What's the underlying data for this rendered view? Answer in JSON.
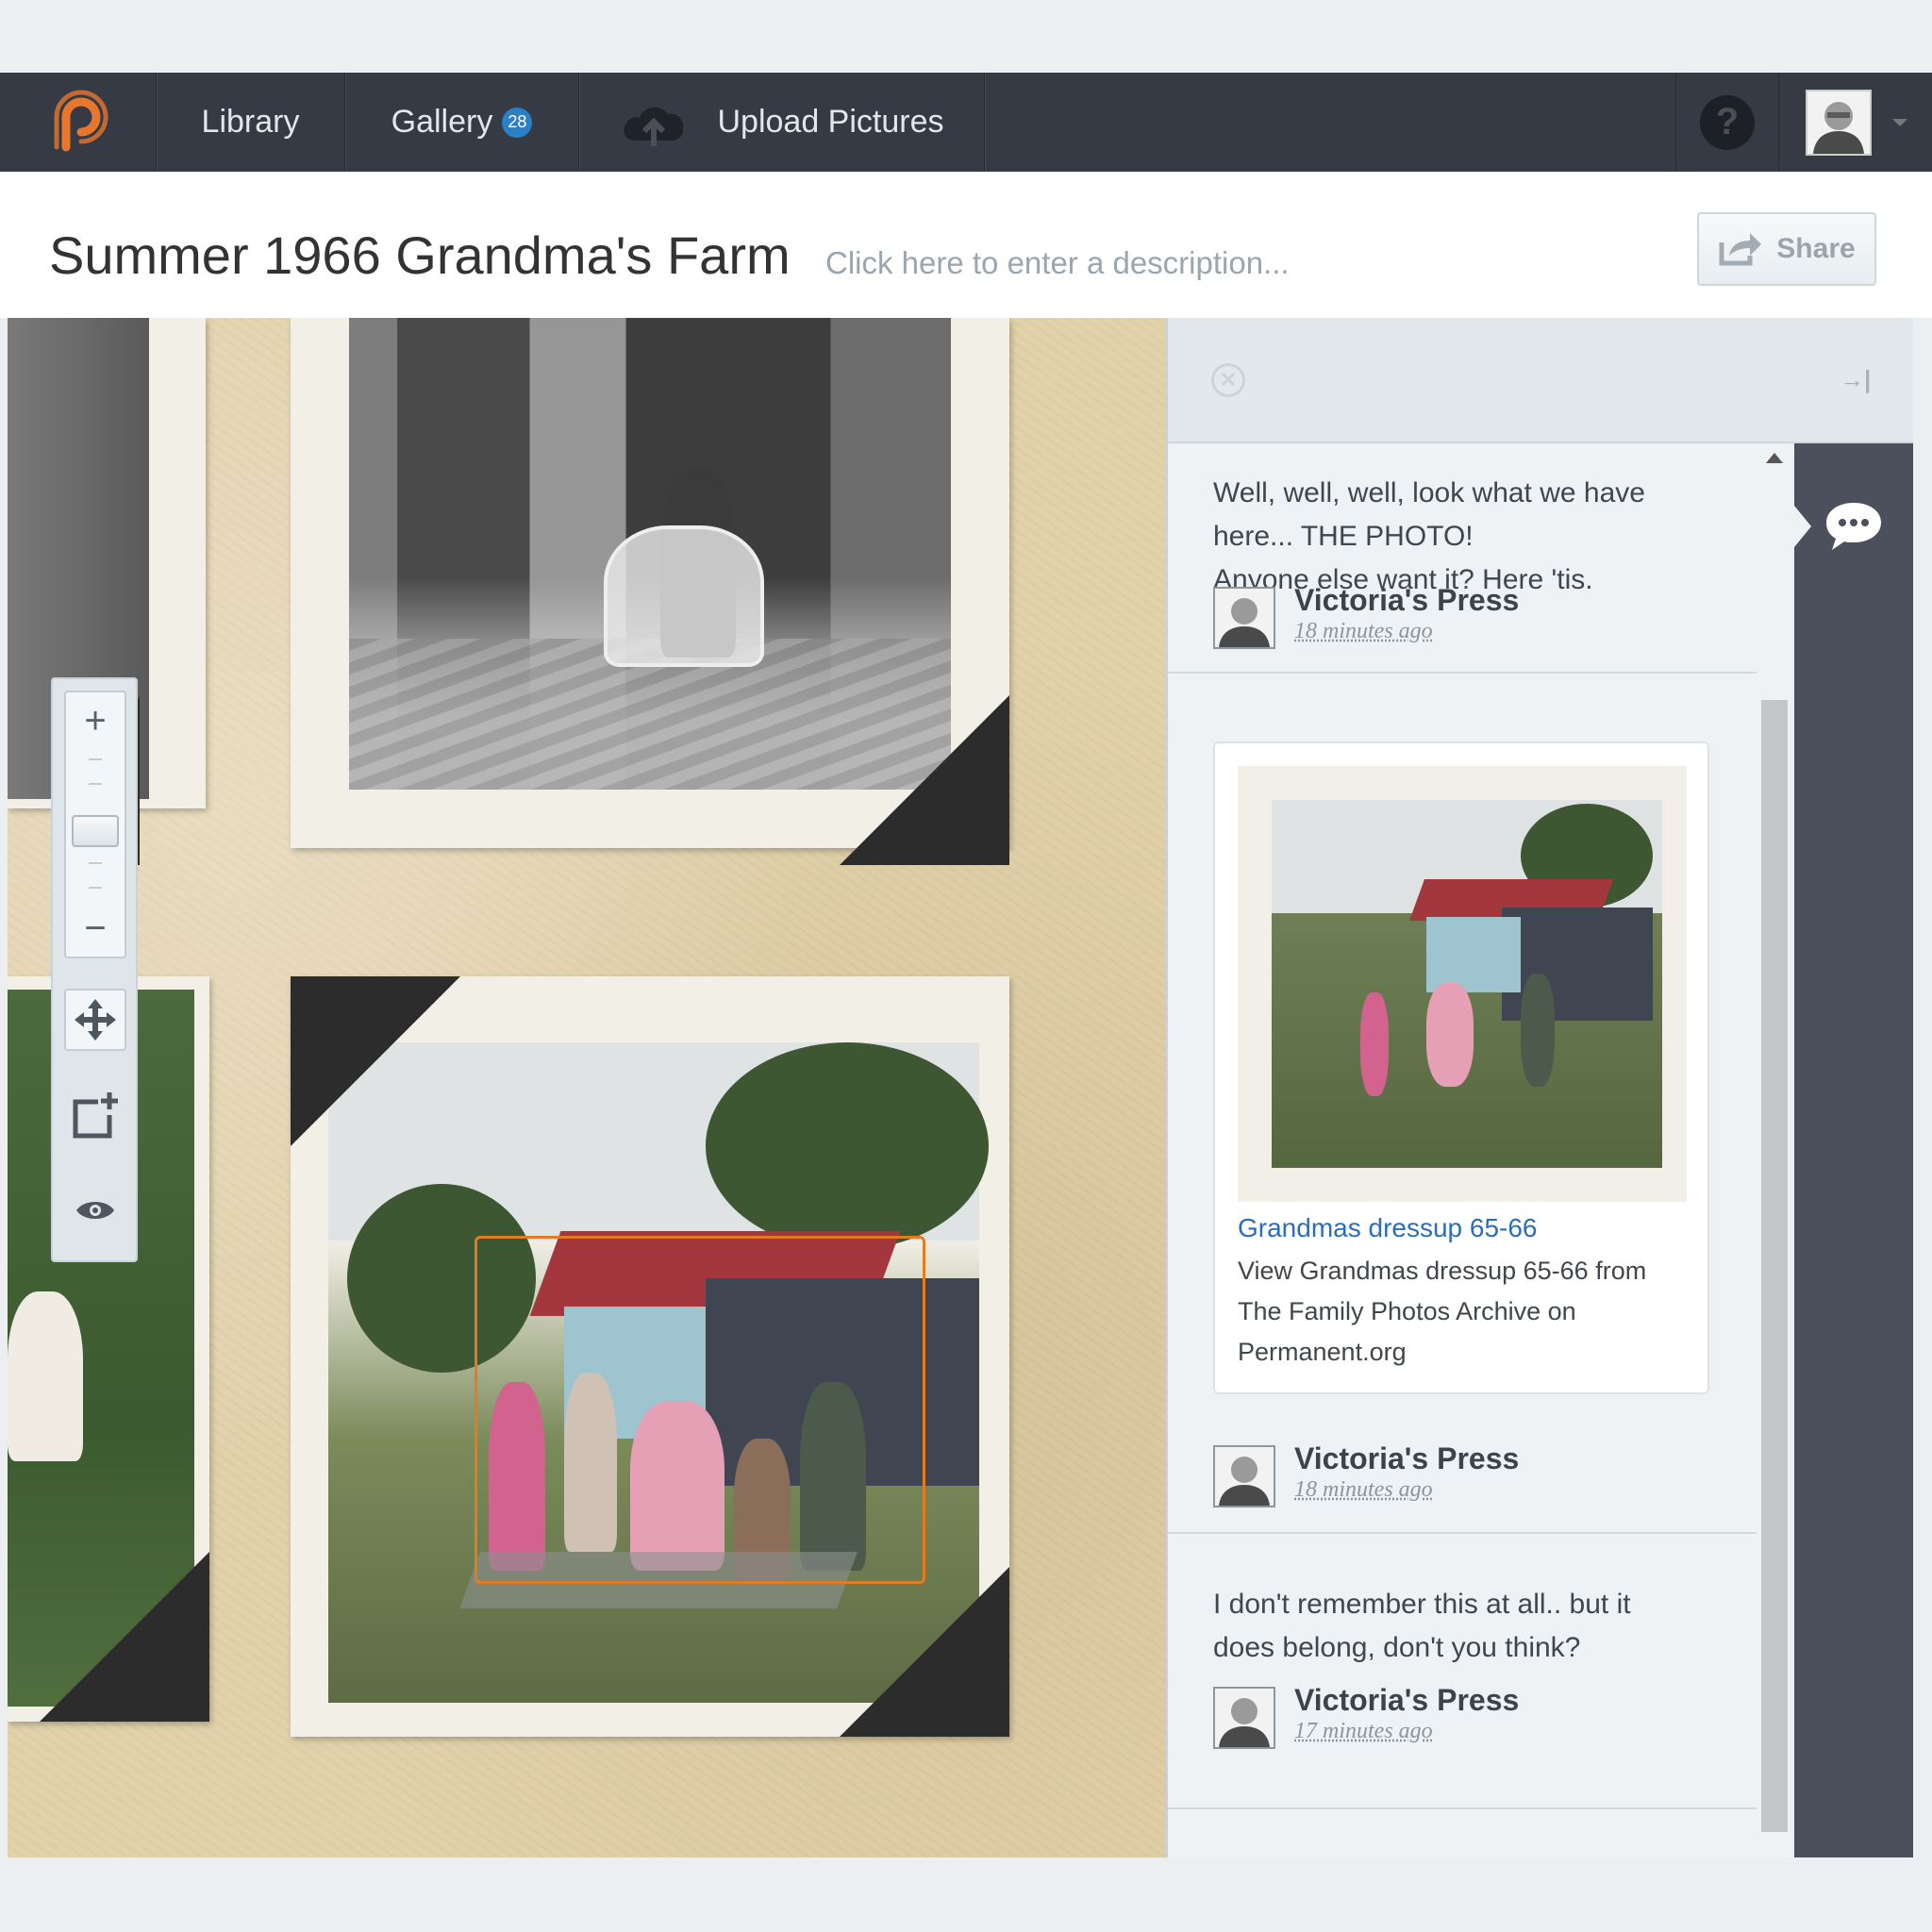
{
  "nav": {
    "logo": "permanent-logo",
    "library": "Library",
    "gallery": "Gallery",
    "gallery_badge": "28",
    "upload": "Upload Pictures",
    "help": "?",
    "accent": "#e8762d",
    "bar_color": "#353a44"
  },
  "album": {
    "title": "Summer 1966 Grandma's Farm",
    "description_placeholder": "Click here to enter a description...",
    "share": "Share"
  },
  "toolbar": {
    "zoom_in": "+",
    "zoom_out": "−",
    "icons": [
      "move-icon",
      "add-frame-icon",
      "eye-icon"
    ]
  },
  "selection_color": "#e57a1e",
  "comments": [
    {
      "text_lines": [
        "Well, well, well, look what we have",
        "here... THE PHOTO!",
        "Anyone else want it? Here 'tis."
      ],
      "author": "Victoria's Press",
      "time": "18 minutes ago"
    },
    {
      "link_title": "Grandmas dressup 65-66",
      "link_desc": "View Grandmas dressup 65-66 from The Family Photos Archive on Permanent.org",
      "author": "Victoria's Press",
      "time": "18 minutes ago"
    },
    {
      "text_lines": [
        "I don't remember this at all.. but it",
        "does belong, don't you think?"
      ],
      "author": "Victoria's Press",
      "time": "17 minutes ago"
    }
  ]
}
